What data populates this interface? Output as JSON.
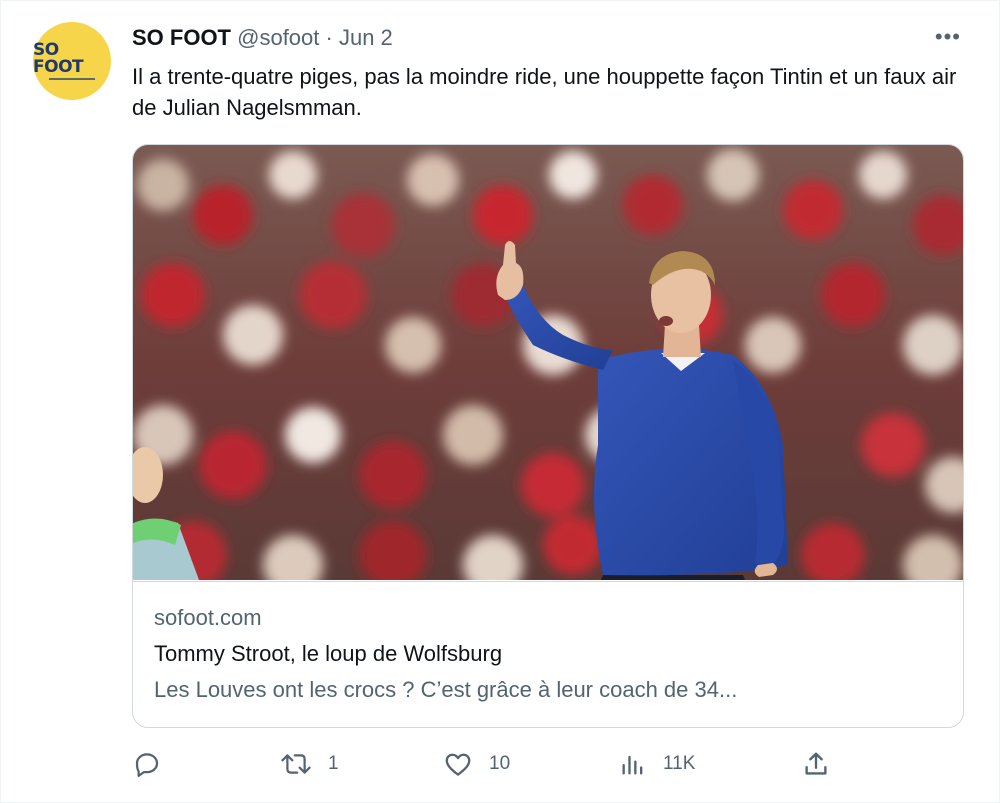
{
  "author": {
    "name": "SO FOOT",
    "handle": "@sofoot",
    "separator": "·",
    "date": "Jun 2",
    "avatar_text": "SO FOOT",
    "avatar_color": "#f7d54a"
  },
  "menu": {
    "more_label": "•••"
  },
  "tweet": {
    "text": "Il a trente-quatre piges, pas la moindre ride, une houppette façon Tintin et un faux air de Julian Nagelsmman."
  },
  "card": {
    "domain": "sofoot.com",
    "title": "Tommy Stroot, le loup de Wolfsburg",
    "description": "Les Louves ont les crocs ? C’est grâce à leur coach de 34..."
  },
  "actions": {
    "reply": {
      "icon": "reply-icon",
      "count": ""
    },
    "retweet": {
      "icon": "retweet-icon",
      "count": "1"
    },
    "like": {
      "icon": "heart-icon",
      "count": "10"
    },
    "views": {
      "icon": "views-icon",
      "count": "11K"
    },
    "share": {
      "icon": "share-icon"
    }
  },
  "colors": {
    "text": "#0f1419",
    "secondary": "#536471",
    "border": "#cfd9de",
    "sweater": "#2b4aa6"
  }
}
